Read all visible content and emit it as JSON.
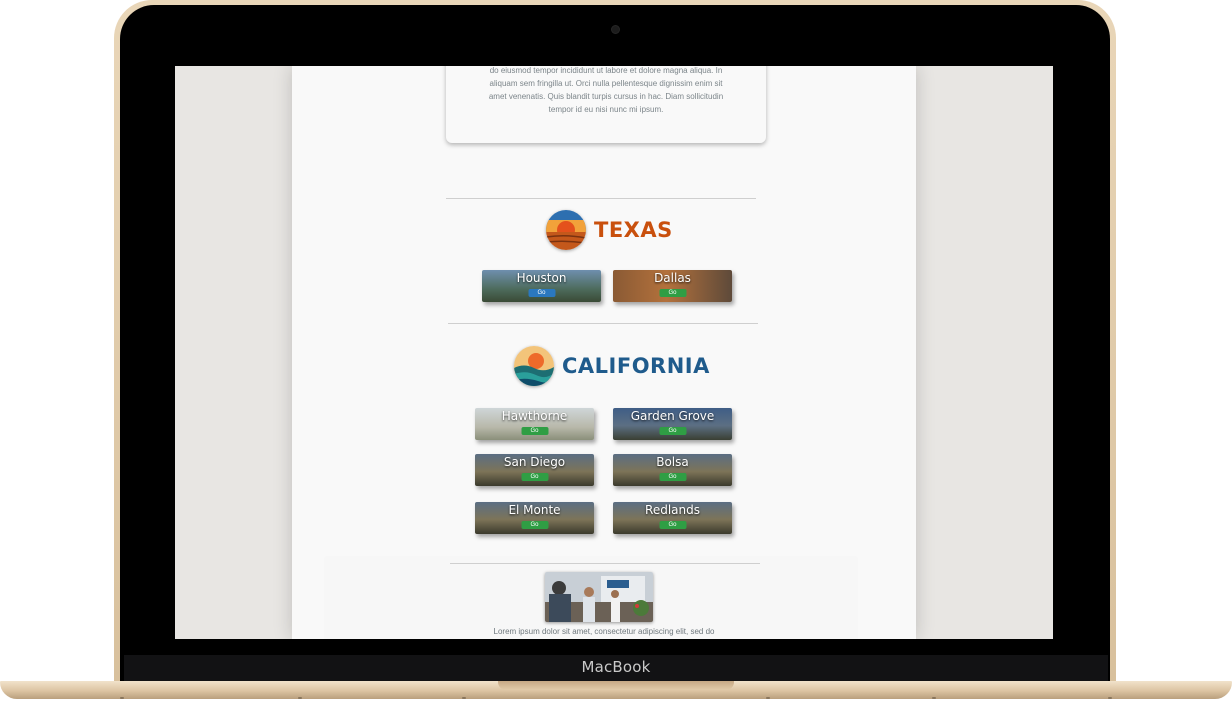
{
  "device": {
    "brand_label": "MacBook"
  },
  "intro_card": {
    "text": "do eiusmod tempor incididunt ut labore et dolore magna aliqua. In aliquam sem fringilla ut. Orci nulla pellentesque dignissim enim sit amet venenatis. Quis blandit turpis cursus in hac. Diam sollicitudin tempor id eu nisi nunc mi ipsum."
  },
  "texas": {
    "title": "TEXAS",
    "title_color": "#c9500d",
    "locations": [
      {
        "name": "Houston",
        "button": "Go"
      },
      {
        "name": "Dallas",
        "button": "Go"
      }
    ]
  },
  "california": {
    "title": "CALIFORNIA",
    "title_color": "#1f5b8c",
    "locations": [
      {
        "name": "Hawthorne",
        "button": "Go"
      },
      {
        "name": "Garden Grove",
        "button": "Go"
      },
      {
        "name": "San Diego",
        "button": "Go"
      },
      {
        "name": "Bolsa",
        "button": "Go"
      },
      {
        "name": "El Monte",
        "button": "Go"
      },
      {
        "name": "Redlands",
        "button": "Go"
      }
    ]
  },
  "footer": {
    "text": "Lorem ipsum dolor sit amet, consectetur adipiscing elit, sed do"
  }
}
